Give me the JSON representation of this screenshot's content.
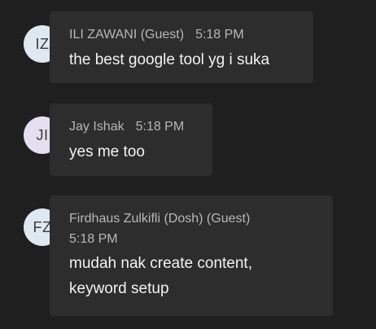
{
  "messages": [
    {
      "initials": "IZ",
      "sender": "ILI ZAWANI (Guest)",
      "time": "5:18 PM",
      "text": "the best google tool yg i suka",
      "avatar_color": "#dde8f0",
      "presence": "offline"
    },
    {
      "initials": "JI",
      "sender": "Jay Ishak",
      "time": "5:18 PM",
      "text": "yes me too",
      "avatar_color": "#e6dff0",
      "presence": "away"
    },
    {
      "initials": "FZ",
      "sender": "Firdhaus Zulkifli (Dosh) (Guest)",
      "time": "5:18 PM",
      "text_line1": "mudah nak create content,",
      "text_line2": "keyword setup",
      "avatar_color": "#dde8f0",
      "presence": "offline"
    }
  ],
  "icons": {
    "offline": "presence-offline-icon",
    "away": "presence-away-clock-icon"
  }
}
